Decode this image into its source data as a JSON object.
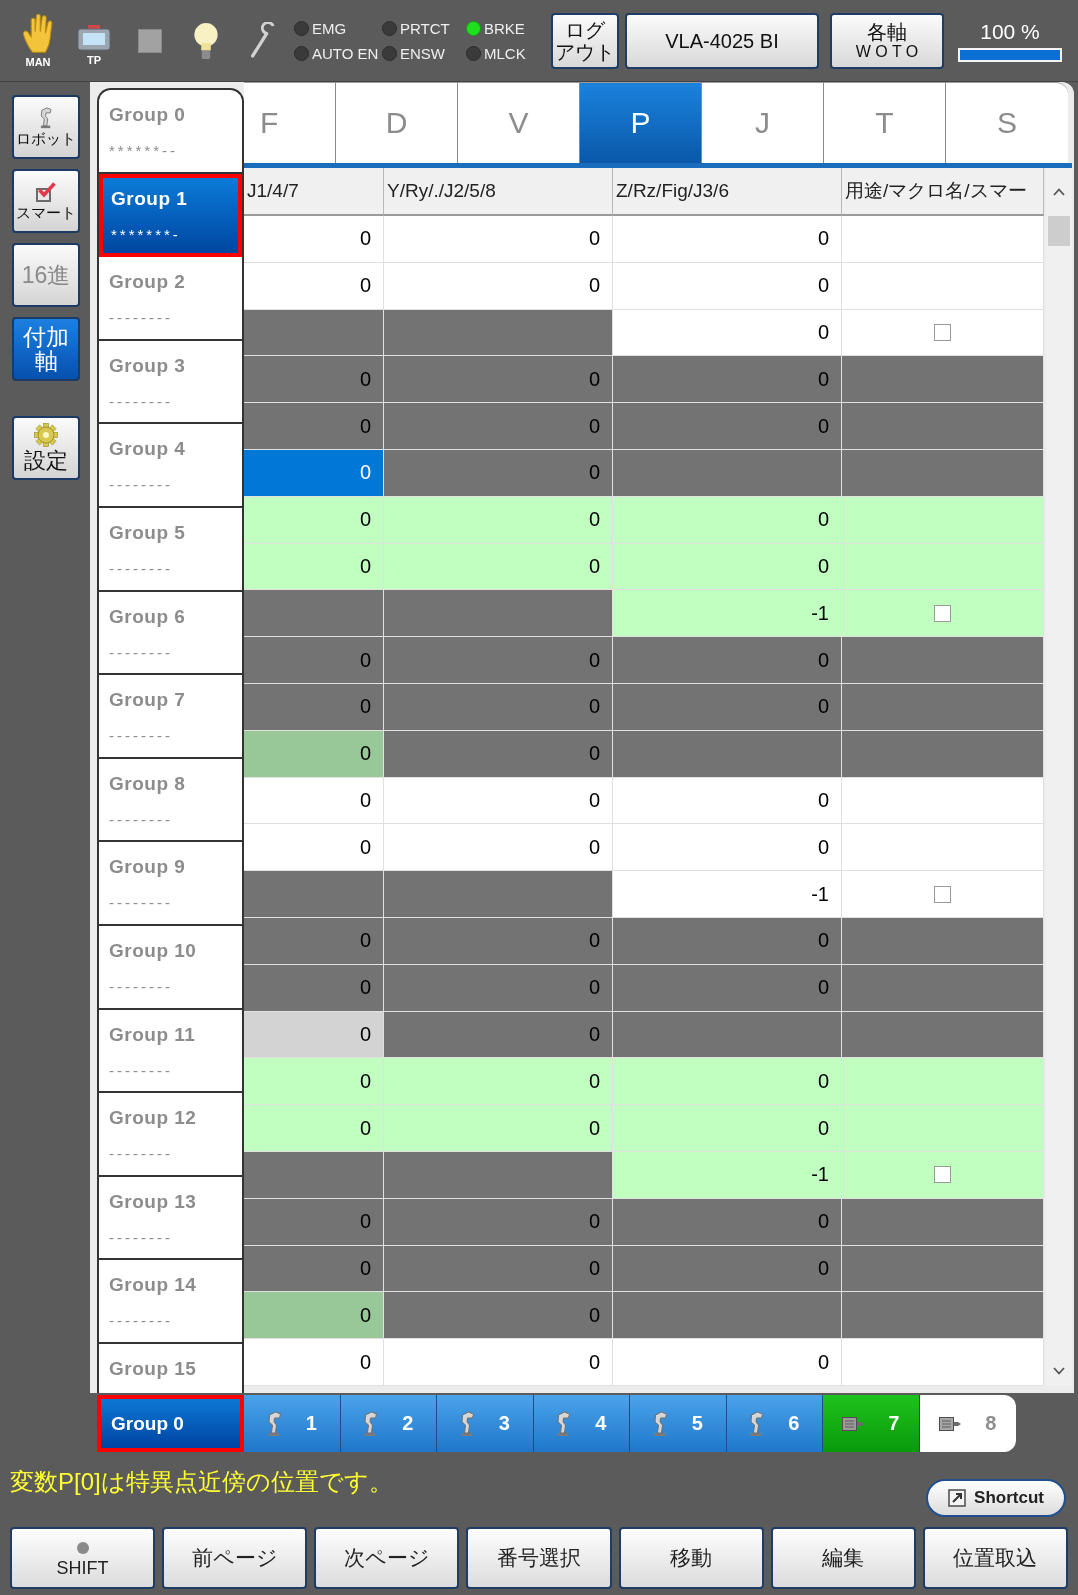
{
  "top_bar": {
    "mode_buttons": [
      {
        "kind": "hand",
        "label": "MAN"
      },
      {
        "kind": "pendant",
        "label": "TP"
      },
      {
        "kind": "square"
      },
      {
        "kind": "bulb"
      },
      {
        "kind": "wrench"
      }
    ],
    "lamps": [
      {
        "label": "EMG",
        "on": false
      },
      {
        "label": "PRTCT",
        "on": false
      },
      {
        "label": "BRKE",
        "on": true
      },
      {
        "label": "AUTO EN",
        "on": false
      },
      {
        "label": "ENSW",
        "on": false
      },
      {
        "label": "MLCK",
        "on": false
      }
    ],
    "logout_button": [
      "ログ",
      "アウト"
    ],
    "robot_button": "VLA-4025 BI",
    "axis_button": [
      "各軸",
      "W O T O"
    ],
    "speed": {
      "text": "100 %",
      "level": 1
    }
  },
  "sidebar": {
    "modes": [
      {
        "kind": "robot",
        "label": "ロボット",
        "selected": false,
        "disabled": false
      },
      {
        "kind": "check",
        "label": "スマート",
        "selected": false,
        "disabled": false
      },
      {
        "kind": "plain",
        "label": "16進",
        "selected": false,
        "disabled": true
      },
      {
        "kind": "plain",
        "label": "付加軸",
        "selected": true,
        "disabled": false
      }
    ],
    "settings_button": "設定"
  },
  "tabs": [
    {
      "label": "F",
      "selected": false
    },
    {
      "label": "D",
      "selected": false
    },
    {
      "label": "V",
      "selected": false
    },
    {
      "label": "P",
      "selected": true
    },
    {
      "label": "J",
      "selected": false
    },
    {
      "label": "T",
      "selected": false
    },
    {
      "label": "S",
      "selected": false
    }
  ],
  "table": {
    "columns": [
      "J1/4/7",
      "Y/Ry/./J2/5/8",
      "Z/Rz/Fig/J3/6",
      "用途/マクロ名/スマー"
    ],
    "rows": [
      {
        "cells": [
          {
            "kind": "num",
            "text": "0",
            "color": "#ffffff"
          },
          {
            "kind": "num",
            "text": "0",
            "color": "#ffffff"
          },
          {
            "kind": "num",
            "text": "0",
            "color": "#ffffff"
          },
          {
            "kind": "blank",
            "color": "#ffffff"
          }
        ]
      },
      {
        "cells": [
          {
            "kind": "num",
            "text": "0",
            "color": "#ffffff"
          },
          {
            "kind": "num",
            "text": "0",
            "color": "#ffffff"
          },
          {
            "kind": "num",
            "text": "0",
            "color": "#ffffff"
          },
          {
            "kind": "blank",
            "color": "#ffffff"
          }
        ]
      },
      {
        "cells": [
          {
            "kind": "blank",
            "color": "#737373"
          },
          {
            "kind": "blank",
            "color": "#737373"
          },
          {
            "kind": "num",
            "text": "0",
            "color": "#ffffff"
          },
          {
            "kind": "check",
            "checked": false,
            "color": "#ffffff"
          }
        ]
      },
      {
        "cells": [
          {
            "kind": "num",
            "text": "0",
            "color": "#737373"
          },
          {
            "kind": "num",
            "text": "0",
            "color": "#737373"
          },
          {
            "kind": "num",
            "text": "0",
            "color": "#737373"
          },
          {
            "kind": "blank",
            "color": "#737373"
          }
        ]
      },
      {
        "cells": [
          {
            "kind": "num",
            "text": "0",
            "color": "#737373"
          },
          {
            "kind": "num",
            "text": "0",
            "color": "#737373"
          },
          {
            "kind": "num",
            "text": "0",
            "color": "#737373"
          },
          {
            "kind": "blank",
            "color": "#737373"
          }
        ]
      },
      {
        "cells": [
          {
            "kind": "num",
            "text": "0",
            "color": "#0078d7"
          },
          {
            "kind": "num",
            "text": "0",
            "color": "#737373"
          },
          {
            "kind": "blank",
            "color": "#737373"
          },
          {
            "kind": "blank",
            "color": "#737373"
          }
        ]
      },
      {
        "cells": [
          {
            "kind": "num",
            "text": "0",
            "color": "#c0ffc0"
          },
          {
            "kind": "num",
            "text": "0",
            "color": "#c0ffc0"
          },
          {
            "kind": "num",
            "text": "0",
            "color": "#c0ffc0"
          },
          {
            "kind": "blank",
            "color": "#c0ffc0"
          }
        ]
      },
      {
        "cells": [
          {
            "kind": "num",
            "text": "0",
            "color": "#c0ffc0"
          },
          {
            "kind": "num",
            "text": "0",
            "color": "#c0ffc0"
          },
          {
            "kind": "num",
            "text": "0",
            "color": "#c0ffc0"
          },
          {
            "kind": "blank",
            "color": "#c0ffc0"
          }
        ]
      },
      {
        "cells": [
          {
            "kind": "blank",
            "color": "#737373"
          },
          {
            "kind": "blank",
            "color": "#737373"
          },
          {
            "kind": "num",
            "text": "-1",
            "color": "#c0ffc0"
          },
          {
            "kind": "check",
            "checked": false,
            "color": "#c0ffc0"
          }
        ]
      },
      {
        "cells": [
          {
            "kind": "num",
            "text": "0",
            "color": "#737373"
          },
          {
            "kind": "num",
            "text": "0",
            "color": "#737373"
          },
          {
            "kind": "num",
            "text": "0",
            "color": "#737373"
          },
          {
            "kind": "blank",
            "color": "#737373"
          }
        ]
      },
      {
        "cells": [
          {
            "kind": "num",
            "text": "0",
            "color": "#737373"
          },
          {
            "kind": "num",
            "text": "0",
            "color": "#737373"
          },
          {
            "kind": "num",
            "text": "0",
            "color": "#737373"
          },
          {
            "kind": "blank",
            "color": "#737373"
          }
        ]
      },
      {
        "cells": [
          {
            "kind": "num",
            "text": "0",
            "color": "#98c898"
          },
          {
            "kind": "num",
            "text": "0",
            "color": "#737373"
          },
          {
            "kind": "blank",
            "color": "#737373"
          },
          {
            "kind": "blank",
            "color": "#737373"
          }
        ]
      },
      {
        "cells": [
          {
            "kind": "num",
            "text": "0",
            "color": "#ffffff"
          },
          {
            "kind": "num",
            "text": "0",
            "color": "#ffffff"
          },
          {
            "kind": "num",
            "text": "0",
            "color": "#ffffff"
          },
          {
            "kind": "blank",
            "color": "#ffffff"
          }
        ]
      },
      {
        "cells": [
          {
            "kind": "num",
            "text": "0",
            "color": "#ffffff"
          },
          {
            "kind": "num",
            "text": "0",
            "color": "#ffffff"
          },
          {
            "kind": "num",
            "text": "0",
            "color": "#ffffff"
          },
          {
            "kind": "blank",
            "color": "#ffffff"
          }
        ]
      },
      {
        "cells": [
          {
            "kind": "blank",
            "color": "#737373"
          },
          {
            "kind": "blank",
            "color": "#737373"
          },
          {
            "kind": "num",
            "text": "-1",
            "color": "#ffffff"
          },
          {
            "kind": "check",
            "checked": false,
            "color": "#ffffff"
          }
        ]
      },
      {
        "cells": [
          {
            "kind": "num",
            "text": "0",
            "color": "#737373"
          },
          {
            "kind": "num",
            "text": "0",
            "color": "#737373"
          },
          {
            "kind": "num",
            "text": "0",
            "color": "#737373"
          },
          {
            "kind": "blank",
            "color": "#737373"
          }
        ]
      },
      {
        "cells": [
          {
            "kind": "num",
            "text": "0",
            "color": "#737373"
          },
          {
            "kind": "num",
            "text": "0",
            "color": "#737373"
          },
          {
            "kind": "num",
            "text": "0",
            "color": "#737373"
          },
          {
            "kind": "blank",
            "color": "#737373"
          }
        ]
      },
      {
        "cells": [
          {
            "kind": "num",
            "text": "0",
            "color": "#d3d3d3"
          },
          {
            "kind": "num",
            "text": "0",
            "color": "#737373"
          },
          {
            "kind": "blank",
            "color": "#737373"
          },
          {
            "kind": "blank",
            "color": "#737373"
          }
        ]
      },
      {
        "cells": [
          {
            "kind": "num",
            "text": "0",
            "color": "#c0ffc0"
          },
          {
            "kind": "num",
            "text": "0",
            "color": "#c0ffc0"
          },
          {
            "kind": "num",
            "text": "0",
            "color": "#c0ffc0"
          },
          {
            "kind": "blank",
            "color": "#c0ffc0"
          }
        ]
      },
      {
        "cells": [
          {
            "kind": "num",
            "text": "0",
            "color": "#c0ffc0"
          },
          {
            "kind": "num",
            "text": "0",
            "color": "#c0ffc0"
          },
          {
            "kind": "num",
            "text": "0",
            "color": "#c0ffc0"
          },
          {
            "kind": "blank",
            "color": "#c0ffc0"
          }
        ]
      },
      {
        "cells": [
          {
            "kind": "blank",
            "color": "#737373"
          },
          {
            "kind": "blank",
            "color": "#737373"
          },
          {
            "kind": "num",
            "text": "-1",
            "color": "#c0ffc0"
          },
          {
            "kind": "check",
            "checked": false,
            "color": "#c0ffc0"
          }
        ]
      },
      {
        "cells": [
          {
            "kind": "num",
            "text": "0",
            "color": "#737373"
          },
          {
            "kind": "num",
            "text": "0",
            "color": "#737373"
          },
          {
            "kind": "num",
            "text": "0",
            "color": "#737373"
          },
          {
            "kind": "blank",
            "color": "#737373"
          }
        ]
      },
      {
        "cells": [
          {
            "kind": "num",
            "text": "0",
            "color": "#737373"
          },
          {
            "kind": "num",
            "text": "0",
            "color": "#737373"
          },
          {
            "kind": "num",
            "text": "0",
            "color": "#737373"
          },
          {
            "kind": "blank",
            "color": "#737373"
          }
        ]
      },
      {
        "cells": [
          {
            "kind": "num",
            "text": "0",
            "color": "#98c898"
          },
          {
            "kind": "num",
            "text": "0",
            "color": "#737373"
          },
          {
            "kind": "blank",
            "color": "#737373"
          },
          {
            "kind": "blank",
            "color": "#737373"
          }
        ]
      },
      {
        "cells": [
          {
            "kind": "num",
            "text": "0",
            "color": "#ffffff"
          },
          {
            "kind": "num",
            "text": "0",
            "color": "#ffffff"
          },
          {
            "kind": "num",
            "text": "0",
            "color": "#ffffff"
          },
          {
            "kind": "blank",
            "color": "#ffffff"
          }
        ]
      }
    ]
  },
  "group_list": {
    "items": [
      {
        "name": "Group 0",
        "mask": "******--",
        "selected": false
      },
      {
        "name": "Group 1",
        "mask": "*******-",
        "selected": true
      },
      {
        "name": "Group 2",
        "mask": "--------",
        "selected": false
      },
      {
        "name": "Group 3",
        "mask": "--------",
        "selected": false
      },
      {
        "name": "Group 4",
        "mask": "--------",
        "selected": false
      },
      {
        "name": "Group 5",
        "mask": "--------",
        "selected": false
      },
      {
        "name": "Group 6",
        "mask": "--------",
        "selected": false
      },
      {
        "name": "Group 7",
        "mask": "--------",
        "selected": false
      },
      {
        "name": "Group 8",
        "mask": "--------",
        "selected": false
      },
      {
        "name": "Group 9",
        "mask": "--------",
        "selected": false
      },
      {
        "name": "Group 10",
        "mask": "--------",
        "selected": false
      },
      {
        "name": "Group 11",
        "mask": "--------",
        "selected": false
      },
      {
        "name": "Group 12",
        "mask": "--------",
        "selected": false
      },
      {
        "name": "Group 13",
        "mask": "--------",
        "selected": false
      },
      {
        "name": "Group 14",
        "mask": "--------",
        "selected": false
      },
      {
        "name": "Group 15",
        "selected": false
      }
    ]
  },
  "current_group": "Group 0",
  "robot_tabs": [
    {
      "kind": "robot",
      "label": "1",
      "selected": false,
      "disabled": false
    },
    {
      "kind": "robot",
      "label": "2",
      "selected": false,
      "disabled": false
    },
    {
      "kind": "robot",
      "label": "3",
      "selected": false,
      "disabled": false
    },
    {
      "kind": "robot",
      "label": "4",
      "selected": false,
      "disabled": false
    },
    {
      "kind": "robot",
      "label": "5",
      "selected": false,
      "disabled": false
    },
    {
      "kind": "robot",
      "label": "6",
      "selected": false,
      "disabled": false
    },
    {
      "kind": "motor",
      "label": "7",
      "selected": true,
      "disabled": false
    },
    {
      "kind": "motor",
      "label": "8",
      "selected": false,
      "disabled": true
    }
  ],
  "message": "変数P[0]は特異点近傍の位置です。",
  "shortcut_button": "Shortcut",
  "shift_button": {
    "label": "SHIFT",
    "on": false
  },
  "buttons": [
    "前ページ",
    "次ページ",
    "番号選択",
    "移動",
    "編集",
    "位置取込"
  ]
}
